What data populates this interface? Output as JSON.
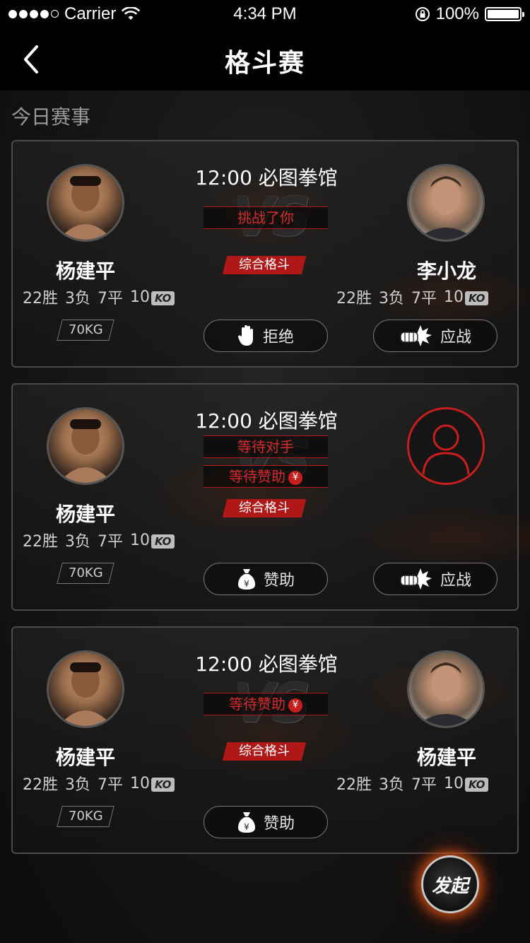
{
  "status_bar": {
    "carrier": "Carrier",
    "time": "4:34 PM",
    "battery": "100%"
  },
  "nav": {
    "title": "格斗赛"
  },
  "section_title": "今日赛事",
  "matches": [
    {
      "time_venue": "12:00  必图拳馆",
      "banners": [
        "挑战了你"
      ],
      "type": "综合格斗",
      "left": {
        "name": "杨建平",
        "wins": "22胜",
        "losses": "3负",
        "draws": "7平",
        "ko_count": "10",
        "ko_label": "KO",
        "weight": "70KG"
      },
      "right": {
        "name": "李小龙",
        "wins": "22胜",
        "losses": "3负",
        "draws": "7平",
        "ko_count": "10",
        "ko_label": "KO"
      },
      "buttons": [
        {
          "label": "拒绝",
          "icon": "hand-stop-icon"
        },
        {
          "label": "应战",
          "icon": "punch-icon"
        }
      ]
    },
    {
      "time_venue": "12:00  必图拳馆",
      "banners": [
        "等待对手",
        "等待赞助"
      ],
      "type": "综合格斗",
      "left": {
        "name": "杨建平",
        "wins": "22胜",
        "losses": "3负",
        "draws": "7平",
        "ko_count": "10",
        "ko_label": "KO",
        "weight": "70KG"
      },
      "buttons": [
        {
          "label": "赞助",
          "icon": "money-bag-icon"
        },
        {
          "label": "应战",
          "icon": "punch-icon"
        }
      ]
    },
    {
      "time_venue": "12:00  必图拳馆",
      "banners": [
        "等待赞助"
      ],
      "type": "综合格斗",
      "left": {
        "name": "杨建平",
        "wins": "22胜",
        "losses": "3负",
        "draws": "7平",
        "ko_count": "10",
        "ko_label": "KO",
        "weight": "70KG"
      },
      "right": {
        "name": "杨建平",
        "wins": "22胜",
        "losses": "3负",
        "draws": "7平",
        "ko_count": "10",
        "ko_label": "KO"
      },
      "buttons": [
        {
          "label": "赞助",
          "icon": "money-bag-icon"
        }
      ]
    }
  ],
  "vs_text": "VS",
  "coin_symbol": "¥",
  "fab": {
    "label": "发起"
  },
  "colors": {
    "accent": "#c81e1e",
    "background": "#161514",
    "border": "#4a4a4a"
  }
}
